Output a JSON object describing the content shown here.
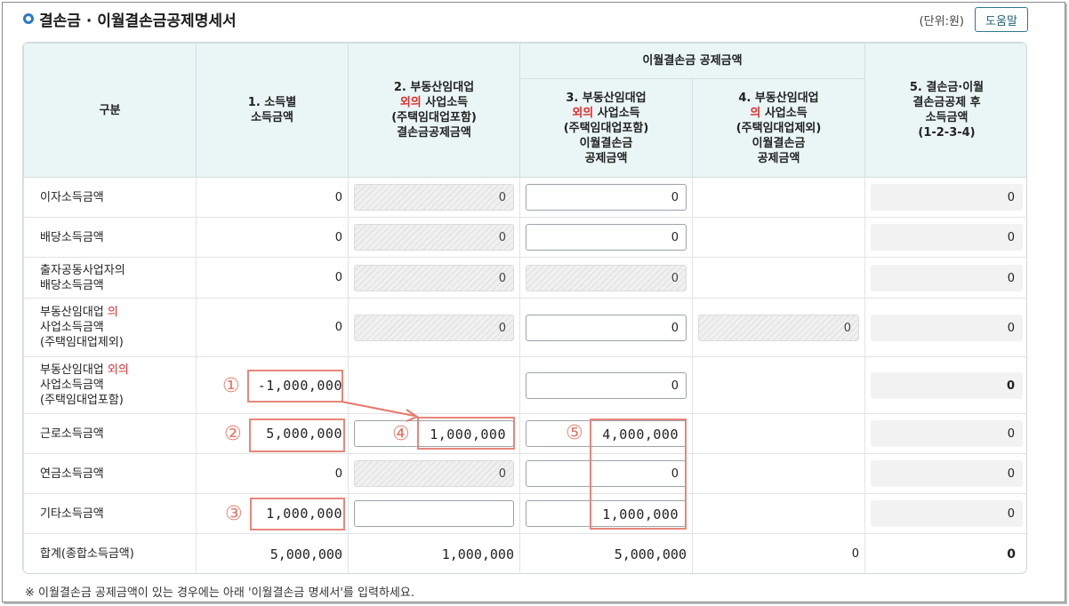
{
  "header": {
    "title": "결손금 · 이월결손금공제명세서",
    "unit": "(단위:원)",
    "help_label": "도움말"
  },
  "table": {
    "col_category": "구분",
    "col1": [
      "1. 소득별",
      "소득금액"
    ],
    "col2": {
      "l1": "2. 부동산임대업",
      "red": "외의",
      "rest": " 사업소득",
      "l3": "(주택임대업포함)",
      "l4": "결손금공제금액"
    },
    "group_header": "이월결손금 공제금액",
    "col3": {
      "l1": "3. 부동산임대업",
      "red": "외의",
      "rest": " 사업소득",
      "l3": "(주택임대업포함)",
      "l4": "이월결손금",
      "l5": "공제금액"
    },
    "col4": {
      "l1": "4. 부동산임대업",
      "red": "의",
      "rest": " 사업소득",
      "l3": "(주택임대업제외)",
      "l4": "이월결손금",
      "l5": "공제금액"
    },
    "col5": [
      "5. 결손금·이월",
      "결손금공제 후",
      "소득금액",
      "(1-2-3-4)"
    ],
    "rows": {
      "interest": {
        "label": "이자소득금액",
        "c1": "0",
        "c2": "0",
        "c3": "0",
        "c5": "0"
      },
      "dividend": {
        "label": "배당소득금액",
        "c1": "0",
        "c2": "0",
        "c3": "0",
        "c5": "0"
      },
      "partner": {
        "l1": "출자공동사업자의",
        "l2": "배당소득금액",
        "c1": "0",
        "c2": "0",
        "c3": "0",
        "c5": "0"
      },
      "rental": {
        "l1a": "부동산임대업 ",
        "l1red": "의",
        "l2": "사업소득금액",
        "l3": "(주택임대업제외)",
        "c1": "0",
        "c2": "0",
        "c3": "0",
        "c4": "0",
        "c5": "0"
      },
      "nonrental": {
        "l1a": "부동산임대업 ",
        "l1red": "외의",
        "l2": "사업소득금액",
        "l3": "(주택임대업포함)",
        "c1": "-1,000,000",
        "c3": "0",
        "c5": "0"
      },
      "labor": {
        "label": "근로소득금액",
        "c1": "5,000,000",
        "c2": "1,000,000",
        "c3": "4,000,000",
        "c5": "0"
      },
      "pension": {
        "label": "연금소득금액",
        "c1": "0",
        "c2": "0",
        "c3": "0",
        "c5": "0"
      },
      "other": {
        "label": "기타소득금액",
        "c1": "1,000,000",
        "c2": "",
        "c3": "1,000,000",
        "c5": "0"
      },
      "total": {
        "label": "합계(종합소득금액)",
        "c1": "5,000,000",
        "c2": "1,000,000",
        "c3": "5,000,000",
        "c4": "0",
        "c5": "0"
      }
    }
  },
  "annotations": {
    "m1": "①",
    "m2": "②",
    "m3": "③",
    "m4": "④",
    "m5": "⑤",
    "color": "#e8786a"
  },
  "note": "※ 이월결손금 공제금액이 있는 경우에는 아래 '이월결손금 명세서'를 입력하세요."
}
